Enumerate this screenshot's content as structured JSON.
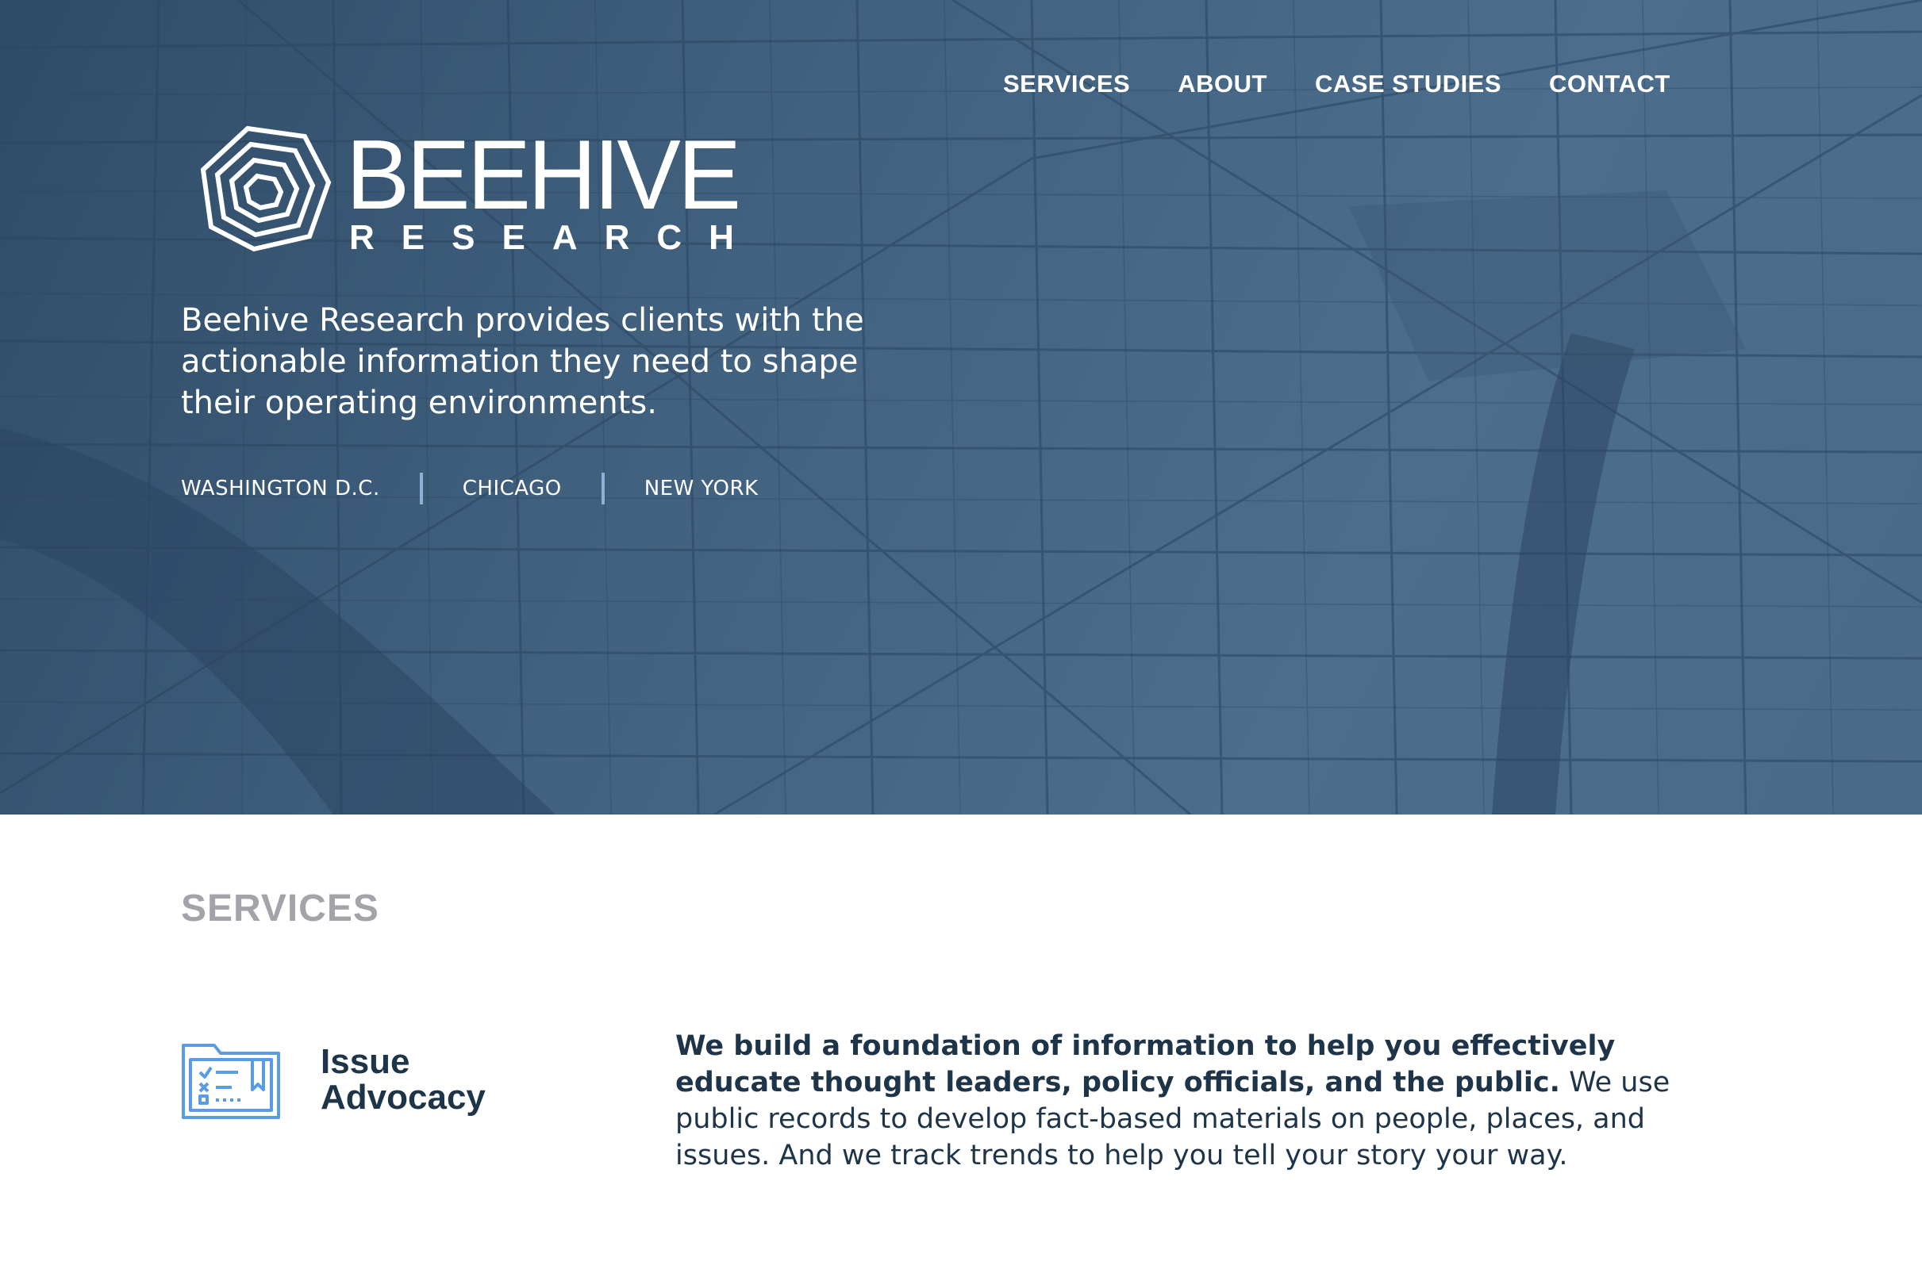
{
  "nav": {
    "items": [
      {
        "label": "SERVICES"
      },
      {
        "label": "ABOUT"
      },
      {
        "label": "CASE STUDIES"
      },
      {
        "label": "CONTACT"
      }
    ]
  },
  "logo": {
    "wordmark": "BEEHIVE",
    "subtitle": "RESEARCH",
    "icon": "hexagon-logo-icon"
  },
  "hero": {
    "tagline": "Beehive Research provides clients with the actionable information they need to shape their operating environments.",
    "cities": [
      "WASHINGTON D.C.",
      "CHICAGO",
      "NEW YORK"
    ],
    "background": "street-map-image"
  },
  "services": {
    "heading": "SERVICES",
    "items": [
      {
        "icon": "folder-checklist-icon",
        "title": "Issue Advocacy",
        "lead": "We build a foundation of information to help you effectively educate thought leaders, policy officials, and the public.",
        "body": " We use public records to develop fact-based materials on people, places, and issues. And we track trends to help you tell your story your way."
      }
    ]
  },
  "colors": {
    "hero_bg": "#40607e",
    "nav_text": "#ffffff",
    "city_separator": "#8fb1d6",
    "services_heading": "#a3a4aa",
    "body_text": "#1e3448",
    "icon_accent": "#5a9be6"
  }
}
